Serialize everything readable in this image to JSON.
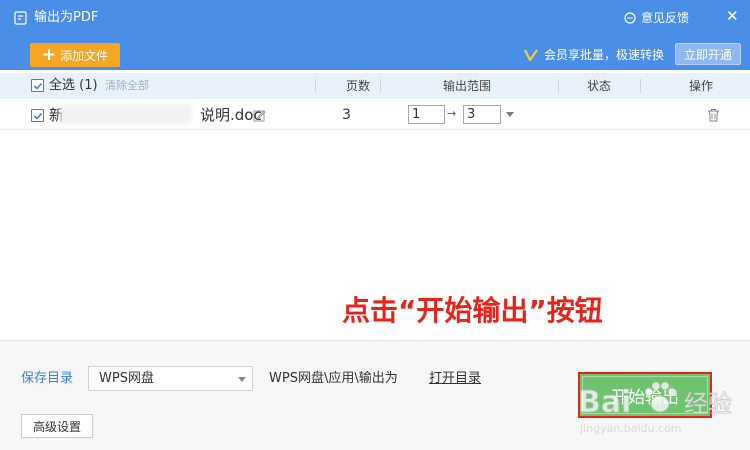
{
  "window": {
    "title": "输出为PDF",
    "feedback": "意见反馈",
    "close": "✕"
  },
  "toolbar": {
    "add_file": "添加文件",
    "vip_promo": "会员享批量，极速转换",
    "activate": "立即开通"
  },
  "table": {
    "select_all": "全选 (1)",
    "clear_all": "清除全部",
    "columns": {
      "pages": "页数",
      "range": "输出范围",
      "status": "状态",
      "action": "操作"
    },
    "rows": [
      {
        "name_start": "新",
        "name_end": "说明.doc",
        "pages": "3",
        "range_from": "1",
        "range_to": "3",
        "range_arrow": "→"
      }
    ]
  },
  "annotation": "点击“开始输出”按钮",
  "footer": {
    "save_label": "保存目录",
    "save_location": "WPS网盘",
    "save_path": "WPS网盘\\应用\\输出为",
    "open_dir": "打开目录",
    "advanced": "高级设置",
    "start": "开始输出"
  },
  "watermark": {
    "brand": "Bai",
    "brand_suffix": "经验",
    "url": "jingyan.baidu.com"
  },
  "colors": {
    "titlebar": "#4b8ee8",
    "add_button": "#f5a623",
    "header_bg": "#e9f1fc",
    "start_button": "#6ec46e",
    "annotation": "#e8231a"
  }
}
